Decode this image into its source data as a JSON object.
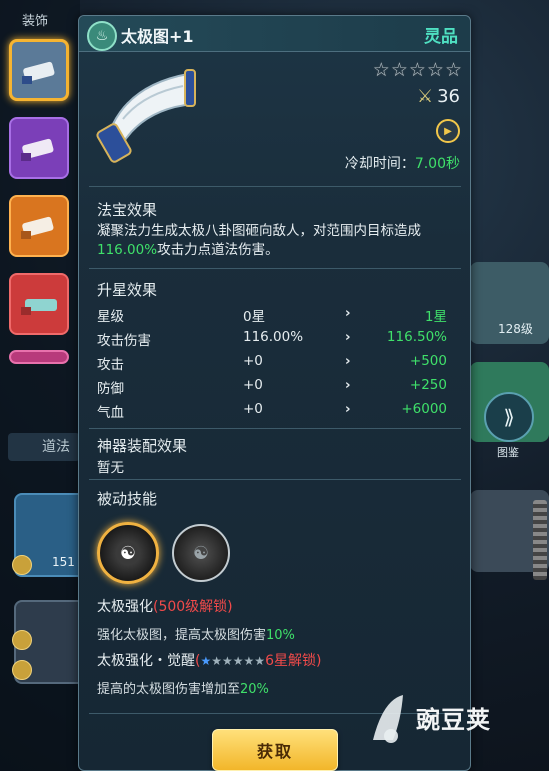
{
  "background": {
    "side_label_top": "装饰",
    "dao_tab": "道法",
    "left_card_1_count": "151",
    "right_card_level": "128级",
    "tujian_label": "图鉴"
  },
  "panel": {
    "title": "太极图+1",
    "quality": "灵品",
    "stars": [
      "☆",
      "☆",
      "☆",
      "☆",
      "☆"
    ],
    "power": "36",
    "cooldown_label": "冷却时间：",
    "cooldown_value": "7.00秒",
    "effect_title": "法宝效果",
    "effect_desc_prefix": "凝聚法力生成太极八卦图砸向敌人，对范围内目标造成",
    "effect_desc_value": "116.00%",
    "effect_desc_suffix": "攻击力点道法伤害。",
    "upgrade_title": "升星效果",
    "upgrade_rows": [
      {
        "name": "星级",
        "current": "0星",
        "next": "1星"
      },
      {
        "name": "攻击伤害",
        "current": "116.00%",
        "next": "116.50%"
      },
      {
        "name": "攻击",
        "current": "+0",
        "next": "+500"
      },
      {
        "name": "防御",
        "current": "+0",
        "next": "+250"
      },
      {
        "name": "气血",
        "current": "+0",
        "next": "+6000"
      }
    ],
    "arrow": "›",
    "artifact_title": "神器装配效果",
    "artifact_none": "暂无",
    "passive_title": "被动技能",
    "skill1_name": "太极强化",
    "skill1_lock": "(500级解锁)",
    "skill1_desc_prefix": "强化太极图，提高太极图伤害",
    "skill1_desc_value": "10%",
    "skill2_name": "太极强化・觉醒",
    "skill2_lock_open": "(",
    "skill2_lock_close": "6星解锁)",
    "skill2_desc_prefix": "提高的太极图伤害增加至",
    "skill2_desc_value": "20%",
    "get_button": "获取"
  },
  "watermark": "豌豆荚",
  "colors": {
    "accent_green": "#3fe06a",
    "quality_teal": "#4fe0c2",
    "lock_red": "#f04a4a",
    "button_gold": "#f2b62a",
    "selected_border": "#f6b431"
  }
}
